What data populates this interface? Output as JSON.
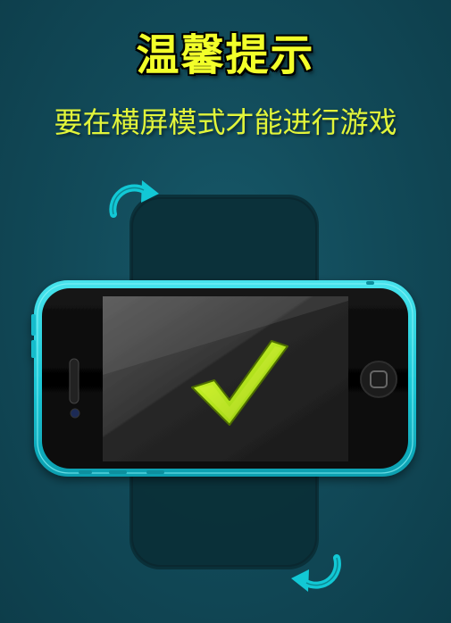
{
  "prompt": {
    "title": "温馨提示",
    "subtitle": "要在横屏模式才能进行游戏"
  },
  "colors": {
    "background": "#124b5a",
    "title": "#f2ff2a",
    "subtitle": "#e2f53a",
    "phone_frame": "#19c7d6",
    "arrow": "#14c9d4",
    "checkmark": "#b7ea12"
  },
  "icons": {
    "rotate_top": "rotate-clockwise-arrow-icon",
    "rotate_bottom": "rotate-clockwise-arrow-icon",
    "check": "check-icon"
  }
}
